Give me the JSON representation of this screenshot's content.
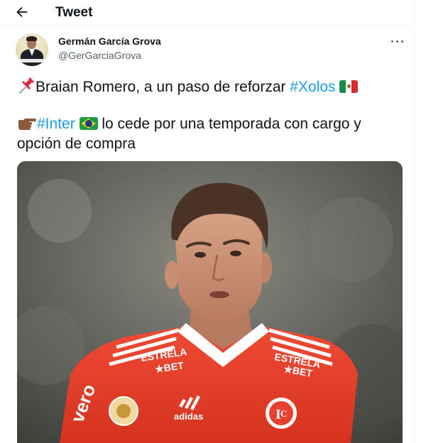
{
  "header": {
    "title": "Tweet",
    "back_icon": "arrow-left-icon"
  },
  "author": {
    "name": "Germán García Grova",
    "handle": "@GerGarciaGrova"
  },
  "tweet": {
    "line1_text": "Braian Romero, a un paso de reforzar ",
    "line1_hashtag": "#Xolos",
    "line3_hashtag": "#Inter",
    "line3_text": " lo cede por una temporada con cargo y",
    "line4_text": "opción de compra",
    "emojis": [
      "pushpin-icon",
      "mexico-flag-icon",
      "pointing-hand-icon",
      "brazil-flag-icon"
    ]
  },
  "media": {
    "jersey_text_left": "ESTRELA\nBET",
    "jersey_text_right": "ESTRELA\nBET",
    "brand": "adidas",
    "sleeve_text": "vero"
  },
  "colors": {
    "link": "#1d9bf0",
    "text": "#0f1419",
    "secondary": "#536471",
    "jersey_red": "#e8402e"
  }
}
